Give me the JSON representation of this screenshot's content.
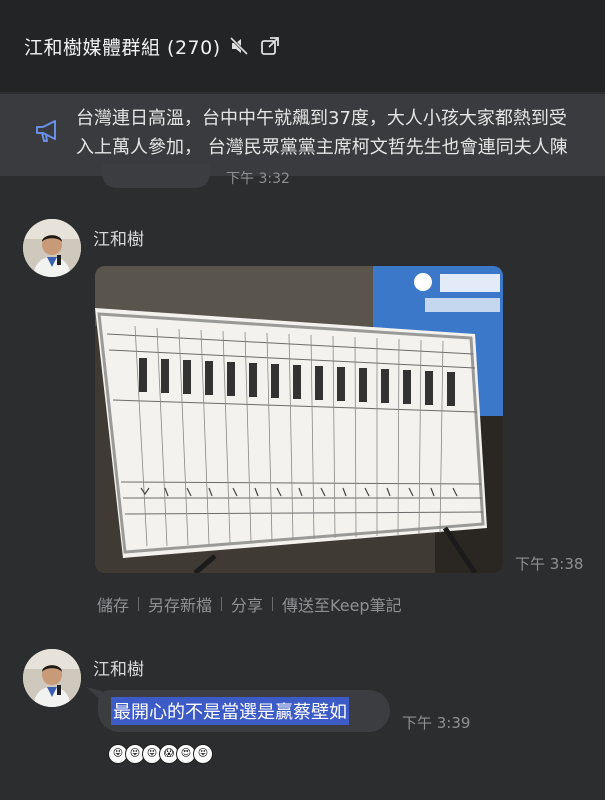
{
  "header": {
    "title": "江和樹媒體群組 (270)",
    "mute_icon": "mute-icon",
    "popout_icon": "popout-icon"
  },
  "announcement": {
    "icon": "megaphone-icon",
    "line1": "台灣連日高溫，台中中午就飆到37度，大人小孩大家都熱到受",
    "line2": "入上萬人參加， 台灣民眾黨黨主席柯文哲先生也會連同夫人陳"
  },
  "previous_message": {
    "time": "下午 3:32"
  },
  "message1": {
    "sender": "江和樹",
    "time": "下午 3:38",
    "photo_description": "vote tally board"
  },
  "photo_actions": [
    "儲存",
    "另存新檔",
    "分享",
    "傳送至Keep筆記"
  ],
  "message2": {
    "sender": "江和樹",
    "text": "最開心的不是當選是贏蔡壁如",
    "time": "下午 3:39"
  },
  "emoji_reactions": [
    "😝",
    "😝",
    "😝",
    "😱",
    "😍",
    "😝"
  ],
  "colors": {
    "background": "#2c2d2f",
    "header": "#232426",
    "bubble": "#3c3d40",
    "selection": "#3d5bc7"
  }
}
